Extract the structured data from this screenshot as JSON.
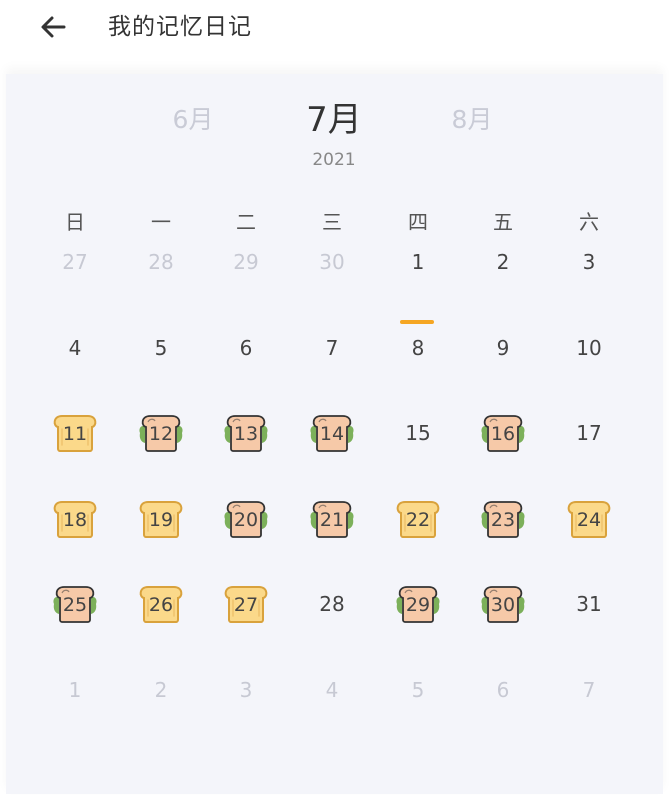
{
  "header": {
    "title": "我的记忆日记"
  },
  "calendar": {
    "prev_month": "6月",
    "current_month": "7月",
    "next_month": "8月",
    "year": "2021",
    "weekdays": [
      "日",
      "一",
      "二",
      "三",
      "四",
      "五",
      "六"
    ],
    "weeks": [
      [
        {
          "d": "27",
          "muted": true
        },
        {
          "d": "28",
          "muted": true
        },
        {
          "d": "29",
          "muted": true
        },
        {
          "d": "30",
          "muted": true
        },
        {
          "d": "1",
          "today": true
        },
        {
          "d": "2"
        },
        {
          "d": "3"
        }
      ],
      [
        {
          "d": "4"
        },
        {
          "d": "5"
        },
        {
          "d": "6"
        },
        {
          "d": "7"
        },
        {
          "d": "8"
        },
        {
          "d": "9"
        },
        {
          "d": "10"
        }
      ],
      [
        {
          "d": "11",
          "icon": "plain-toast-icon"
        },
        {
          "d": "12",
          "icon": "sandwich-toast-icon"
        },
        {
          "d": "13",
          "icon": "sandwich-toast-icon"
        },
        {
          "d": "14",
          "icon": "sandwich-toast-icon"
        },
        {
          "d": "15"
        },
        {
          "d": "16",
          "icon": "sandwich-toast-icon"
        },
        {
          "d": "17"
        }
      ],
      [
        {
          "d": "18",
          "icon": "plain-toast-icon"
        },
        {
          "d": "19",
          "icon": "plain-toast-icon"
        },
        {
          "d": "20",
          "icon": "sandwich-toast-icon"
        },
        {
          "d": "21",
          "icon": "sandwich-toast-icon"
        },
        {
          "d": "22",
          "icon": "plain-toast-icon"
        },
        {
          "d": "23",
          "icon": "sandwich-toast-icon"
        },
        {
          "d": "24",
          "icon": "plain-toast-icon"
        }
      ],
      [
        {
          "d": "25",
          "icon": "sandwich-toast-icon"
        },
        {
          "d": "26",
          "icon": "plain-toast-icon"
        },
        {
          "d": "27",
          "icon": "plain-toast-icon"
        },
        {
          "d": "28"
        },
        {
          "d": "29",
          "icon": "sandwich-toast-icon"
        },
        {
          "d": "30",
          "icon": "sandwich-toast-icon"
        },
        {
          "d": "31"
        }
      ],
      [
        {
          "d": "1",
          "muted": true
        },
        {
          "d": "2",
          "muted": true
        },
        {
          "d": "3",
          "muted": true
        },
        {
          "d": "4",
          "muted": true
        },
        {
          "d": "5",
          "muted": true
        },
        {
          "d": "6",
          "muted": true
        },
        {
          "d": "7",
          "muted": true
        }
      ]
    ]
  },
  "colors": {
    "accent": "#f5a623",
    "toast_fill": "#fbd98a",
    "sandwich_fill": "#f6c9a8",
    "lettuce": "#7cb05a",
    "muted_text": "#c7c9d3",
    "card_bg": "#f4f5fa"
  }
}
